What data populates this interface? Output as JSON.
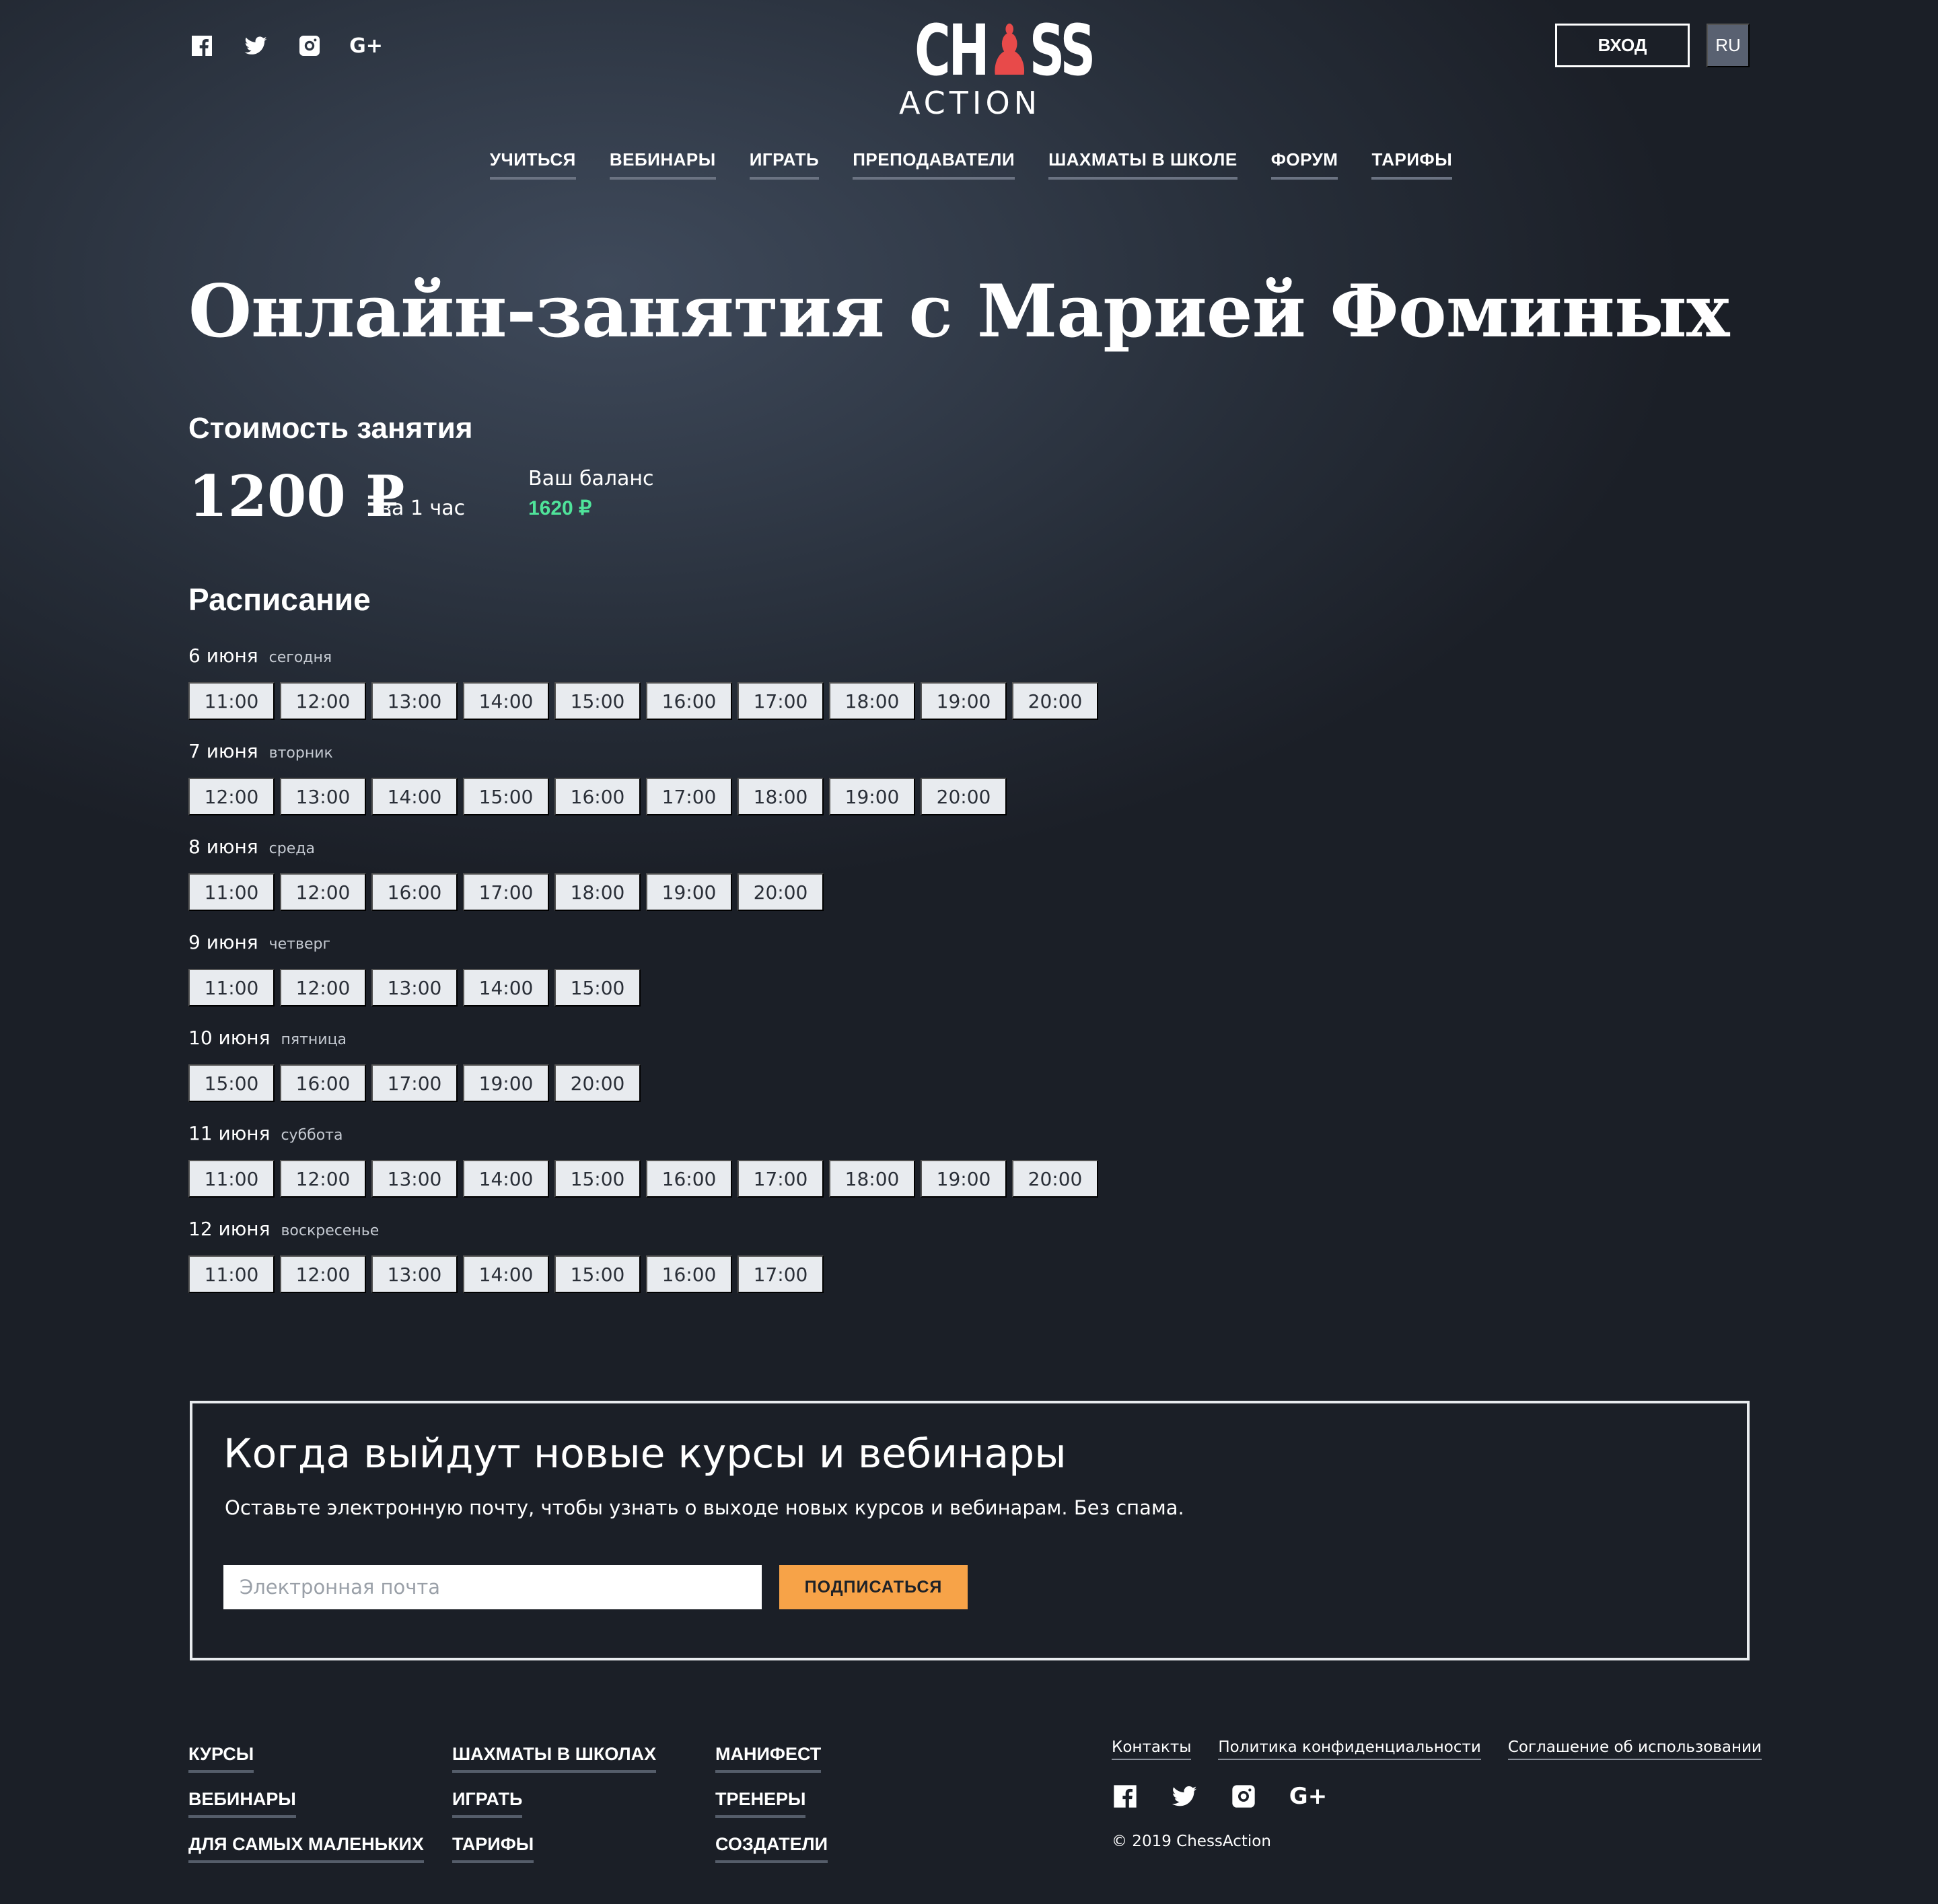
{
  "header": {
    "socials": [
      {
        "icon": "facebook-icon"
      },
      {
        "icon": "twitter-icon"
      },
      {
        "icon": "instagram-icon"
      },
      {
        "icon": "google-plus-icon",
        "label": "G+"
      }
    ],
    "logo": {
      "line1_a": "CH",
      "line1_b": "SS",
      "line2": "ACTION",
      "pawn_color": "#e84a4a"
    },
    "login_label": "ВХОД",
    "lang_label": "RU"
  },
  "nav": {
    "items": [
      "УЧИТЬСЯ",
      "ВЕБИНАРЫ",
      "ИГРАТЬ",
      "ПРЕПОДАВАТЕЛИ",
      "ШАХМАТЫ В ШКОЛЕ",
      "ФОРУМ",
      "ТАРИФЫ"
    ]
  },
  "main": {
    "title": "Онлайн-занятия с Марией Фоминых",
    "price": {
      "heading": "Стоимость занятия",
      "value": "1200 ₽",
      "unit": "за 1 час",
      "balance_label": "Ваш баланс",
      "balance_value": "1620 ₽",
      "balance_color": "#4fe39a"
    },
    "schedule": {
      "heading": "Расписание",
      "days": [
        {
          "date": "6 июня",
          "sub": "сегодня",
          "slots": [
            "11:00",
            "12:00",
            "13:00",
            "14:00",
            "15:00",
            "16:00",
            "17:00",
            "18:00",
            "19:00",
            "20:00"
          ]
        },
        {
          "date": "7 июня",
          "sub": "вторник",
          "slots": [
            "12:00",
            "13:00",
            "14:00",
            "15:00",
            "16:00",
            "17:00",
            "18:00",
            "19:00",
            "20:00"
          ]
        },
        {
          "date": "8 июня",
          "sub": "среда",
          "slots": [
            "11:00",
            "12:00",
            "16:00",
            "17:00",
            "18:00",
            "19:00",
            "20:00"
          ]
        },
        {
          "date": "9 июня",
          "sub": "четверг",
          "slots": [
            "11:00",
            "12:00",
            "13:00",
            "14:00",
            "15:00"
          ]
        },
        {
          "date": "10 июня",
          "sub": "пятница",
          "slots": [
            "15:00",
            "16:00",
            "17:00",
            "19:00",
            "20:00"
          ]
        },
        {
          "date": "11 июня",
          "sub": "суббота",
          "slots": [
            "11:00",
            "12:00",
            "13:00",
            "14:00",
            "15:00",
            "16:00",
            "17:00",
            "18:00",
            "19:00",
            "20:00"
          ]
        },
        {
          "date": "12 июня",
          "sub": "воскресенье",
          "slots": [
            "11:00",
            "12:00",
            "13:00",
            "14:00",
            "15:00",
            "16:00",
            "17:00"
          ]
        }
      ]
    }
  },
  "subscribe": {
    "title": "Когда выйдут новые курсы и вебинары",
    "text": "Оставьте электронную почту, чтобы узнать о выходе новых курсов и вебинарам. Без спама.",
    "input_placeholder": "Электронная почта",
    "button_label": "ПОДПИСАТЬСЯ",
    "button_color": "#f7a348"
  },
  "footer": {
    "col1": [
      "КУРСЫ",
      "ВЕБИНАРЫ",
      "ДЛЯ САМЫХ МАЛЕНЬКИХ"
    ],
    "col2": [
      "ШАХМАТЫ В ШКОЛАХ",
      "ИГРАТЬ",
      "ТАРИФЫ"
    ],
    "col3": [
      "МАНИФЕСТ",
      "ТРЕНЕРЫ",
      "СОЗДАТЕЛИ"
    ],
    "legal": [
      "Контакты",
      "Политика конфиденциальности",
      "Соглашение об использовании"
    ],
    "socials": [
      {
        "icon": "facebook-icon"
      },
      {
        "icon": "twitter-icon"
      },
      {
        "icon": "instagram-icon"
      },
      {
        "icon": "google-plus-icon",
        "label": "G+"
      }
    ],
    "copyright": "© 2019 ChessAction"
  }
}
